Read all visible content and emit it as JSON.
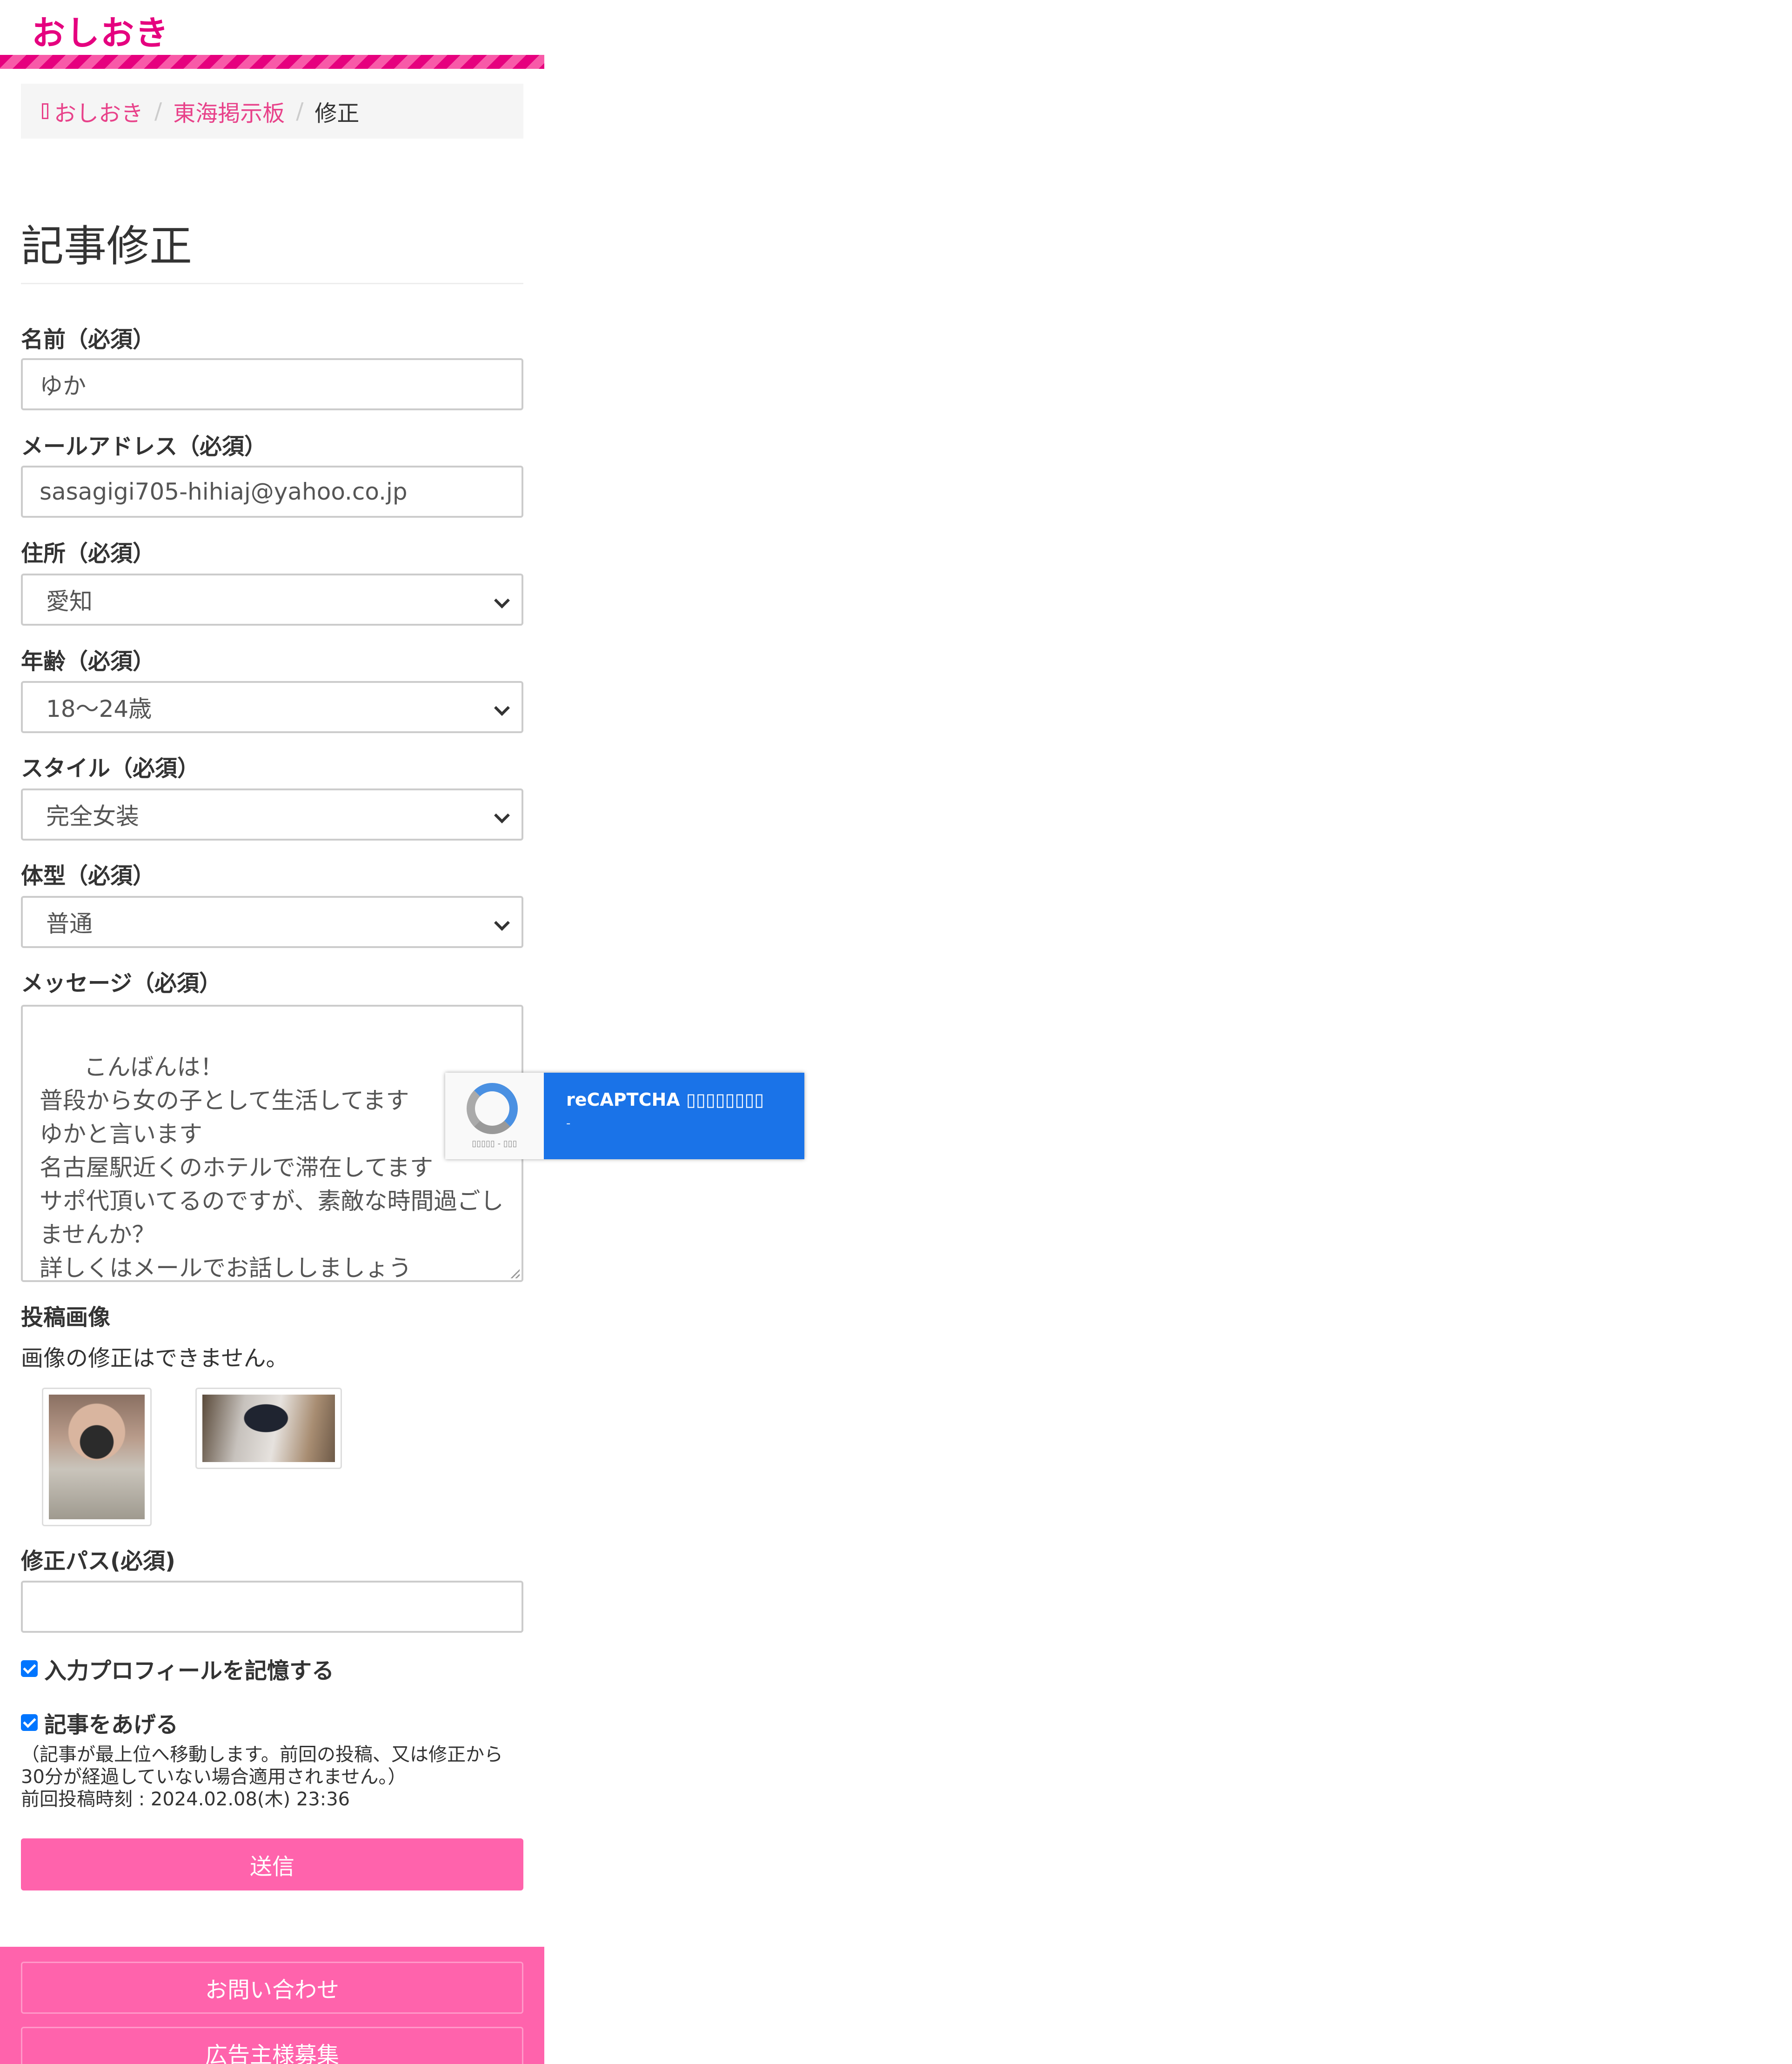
{
  "site": {
    "logo": "おしおき"
  },
  "breadcrumb": {
    "home": "おしおき",
    "board": "東海掲示板",
    "current": "修正",
    "separator": "/"
  },
  "page": {
    "title": "記事修正"
  },
  "form": {
    "name": {
      "label": "名前（必須）",
      "value": "ゆか"
    },
    "email": {
      "label": "メールアドレス（必須）",
      "value": "sasagigi705-hihiaj@yahoo.co.jp"
    },
    "address": {
      "label": "住所（必須）",
      "value": "愛知"
    },
    "age": {
      "label": "年齢（必須）",
      "value": "18〜24歳"
    },
    "style": {
      "label": "スタイル（必須）",
      "value": "完全女装"
    },
    "body_type": {
      "label": "体型（必須）",
      "value": "普通"
    },
    "message": {
      "label": "メッセージ（必須）",
      "value": "こんばんは！\n普段から女の子として生活してます\nゆかと言います\n名古屋駅近くのホテルで滞在してます\nサポ代頂いてるのですが、素敵な時間過ごし\nませんか？\n詳しくはメールでお話ししましょう"
    },
    "images": {
      "label": "投稿画像",
      "note": "画像の修正はできません。"
    },
    "edit_password": {
      "label": "修正パス(必須)",
      "value": ""
    },
    "remember_profile": {
      "label": "入力プロフィールを記憶する",
      "checked": true
    },
    "bump": {
      "label": "記事をあげる",
      "checked": true,
      "note": "（記事が最上位へ移動します。前回の投稿、又は修正から30分が経過していない場合適用されません。）",
      "last_post": "前回投稿時刻 : 2024.02.08(木) 23:36"
    },
    "submit_label": "送信"
  },
  "recaptcha": {
    "title": "reCAPTCHA ▯▯▯▯▯▯▯▯",
    "sub": "-",
    "footer": "▯▯▯▯▯ - ▯▯▯"
  },
  "footer": {
    "contact": "お問い合わせ",
    "advertisers": "広告主様募集"
  },
  "colors": {
    "brand": "#e5007f",
    "accent": "#ff63ac",
    "link": "#e8428a",
    "recaptcha": "#1a73e8"
  }
}
